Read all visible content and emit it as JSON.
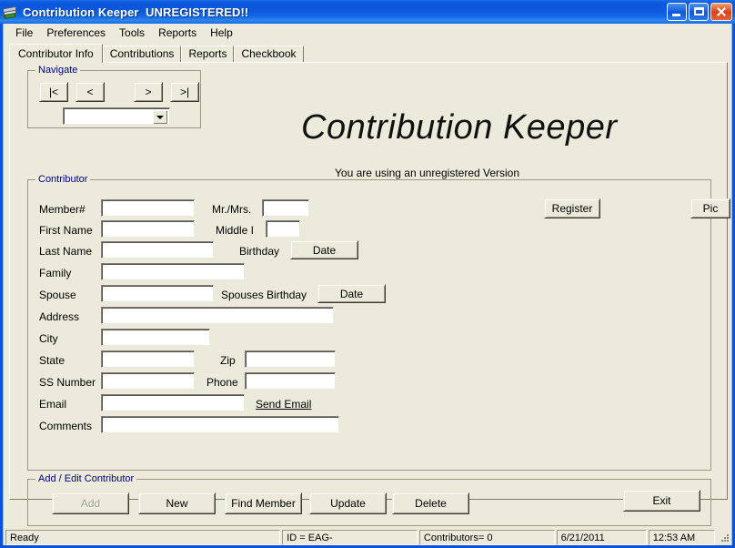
{
  "window": {
    "title": "Contribution Keeper  UNREGISTERED!!",
    "icon": "money-card-icon",
    "minimize_label": "Minimize",
    "maximize_label": "Maximize",
    "close_label": "Close"
  },
  "menu": {
    "items": [
      {
        "label": "File"
      },
      {
        "label": "Preferences"
      },
      {
        "label": "Tools"
      },
      {
        "label": "Reports"
      },
      {
        "label": "Help"
      }
    ]
  },
  "tabs": [
    {
      "label": "Contributor Info",
      "active": true
    },
    {
      "label": "Contributions",
      "active": false
    },
    {
      "label": "Reports",
      "active": false
    },
    {
      "label": "Checkbook",
      "active": false
    }
  ],
  "navigate": {
    "group_label": "Navigate",
    "first_label": "|<",
    "prev_label": "<",
    "next_label": ">",
    "last_label": ">|",
    "combo_value": "",
    "combo_placeholder": ""
  },
  "branding": {
    "headline": "Contribution Keeper",
    "subline": "You are using an unregistered Version"
  },
  "actions": {
    "register_label": "Register",
    "pic_label": "Pic",
    "exit_label": "Exit"
  },
  "contributor": {
    "group_label": "Contributor",
    "fields": {
      "member_number": {
        "label": "Member#",
        "value": ""
      },
      "mr_mrs": {
        "label": "Mr./Mrs.",
        "value": ""
      },
      "first_name": {
        "label": "First Name",
        "value": ""
      },
      "middle_initial": {
        "label": "Middle I",
        "value": ""
      },
      "last_name": {
        "label": "Last Name",
        "value": ""
      },
      "birthday": {
        "label": "Birthday",
        "button_label": "Date"
      },
      "family": {
        "label": "Family",
        "value": ""
      },
      "spouse": {
        "label": "Spouse",
        "value": ""
      },
      "spouses_birthday": {
        "label": "Spouses Birthday",
        "button_label": "Date"
      },
      "address": {
        "label": "Address",
        "value": ""
      },
      "city": {
        "label": "City",
        "value": ""
      },
      "state": {
        "label": "State",
        "value": ""
      },
      "zip": {
        "label": "Zip",
        "value": ""
      },
      "ss_number": {
        "label": "SS Number",
        "value": ""
      },
      "phone": {
        "label": "Phone",
        "value": ""
      },
      "email": {
        "label": "Email",
        "value": ""
      },
      "send_email_link": "Send Email",
      "comments": {
        "label": "Comments",
        "value": ""
      }
    }
  },
  "add_edit": {
    "group_label": "Add / Edit Contributor",
    "add_label": "Add",
    "add_disabled": true,
    "new_label": "New",
    "find_member_label": "Find Member",
    "update_label": "Update",
    "delete_label": "Delete"
  },
  "statusbar": {
    "ready": "Ready",
    "id": "ID = EAG-",
    "contributors": "Contributors= 0",
    "date": "6/21/2011",
    "time": "12:53 AM"
  },
  "colors": {
    "titlebar_blue": "#0B56DC",
    "window_face": "#ECEADA",
    "group_label": "#000080",
    "close_red": "#D8401A"
  }
}
